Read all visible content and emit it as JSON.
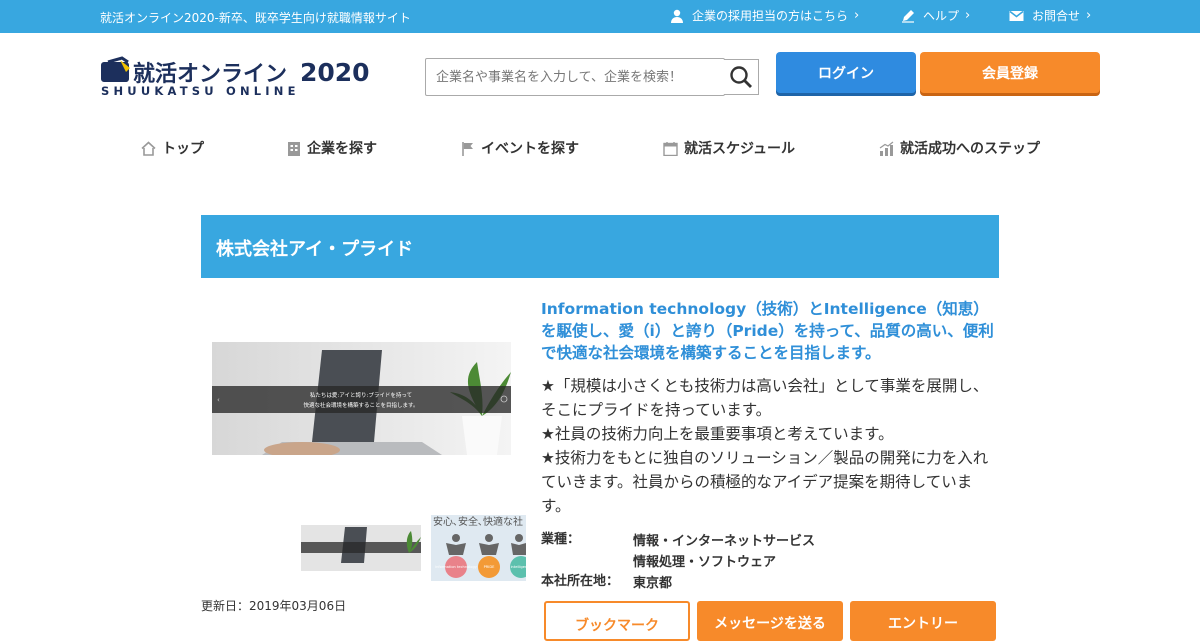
{
  "topbar": {
    "tagline": "就活オンライン2020-新卒、既卒学生向け就職情報サイト",
    "links": [
      {
        "label": "企業の採用担当の方はこちら",
        "icon": "person-icon"
      },
      {
        "label": "ヘルプ",
        "icon": "pencil-icon"
      },
      {
        "label": "お問合せ",
        "icon": "mail-icon"
      }
    ]
  },
  "logo": {
    "main": "就活オンライン",
    "year": "2020",
    "sub": "SHUUKATSU ONLINE"
  },
  "search": {
    "placeholder": "企業名や事業名を入力して、企業を検索！"
  },
  "header_buttons": {
    "login": "ログイン",
    "register": "会員登録"
  },
  "nav": [
    {
      "label": "トップ",
      "icon": "home-icon"
    },
    {
      "label": "企業を探す",
      "icon": "building-icon"
    },
    {
      "label": "イベントを探す",
      "icon": "flag-icon"
    },
    {
      "label": "就活スケジュール",
      "icon": "calendar-icon"
    },
    {
      "label": "就活成功へのステップ",
      "icon": "chart-icon"
    }
  ],
  "company": {
    "name": "株式会社アイ・プライド",
    "hero_caption_1": "私たちは愛:アイと誇り:プライドを持って",
    "hero_caption_2": "快適な社会環境を構築することを目指します。",
    "thumb2_caption": "安心､安全､快適な社",
    "thumb2_circle_labels": [
      "information technology",
      "PRIDE",
      "intelligence"
    ],
    "headline": "Information technology（技術）とIntelligence（知恵）を駆使し、愛（i）と誇り（Pride）を持って、品質の高い、便利で快適な社会環境を構築することを目指します。",
    "description_lines": [
      "★「規模は小さくとも技術力は高い会社」として事業を展開し、そこにプライドを持っています。",
      "★社員の技術力向上を最重要事項と考えています。",
      "★技術力をもとに独自のソリューション／製品の開発に力を入れていきます。社員からの積極的なアイデア提案を期待しています。"
    ],
    "industry_label": "業種：",
    "industry_values": [
      "情報・インターネットサービス",
      "情報処理・ソフトウェア"
    ],
    "hq_label": "本社所在地：",
    "hq_value": "東京都",
    "updated": "更新日：2019年03月06日"
  },
  "actions": {
    "bookmark": "ブックマーク",
    "message": "メッセージを送る",
    "entry": "エントリー"
  },
  "colors": {
    "primary_blue": "#38a7e0",
    "login_blue": "#2f8be0",
    "accent_orange": "#f78a2a",
    "headline_blue": "#2f8fd8"
  }
}
